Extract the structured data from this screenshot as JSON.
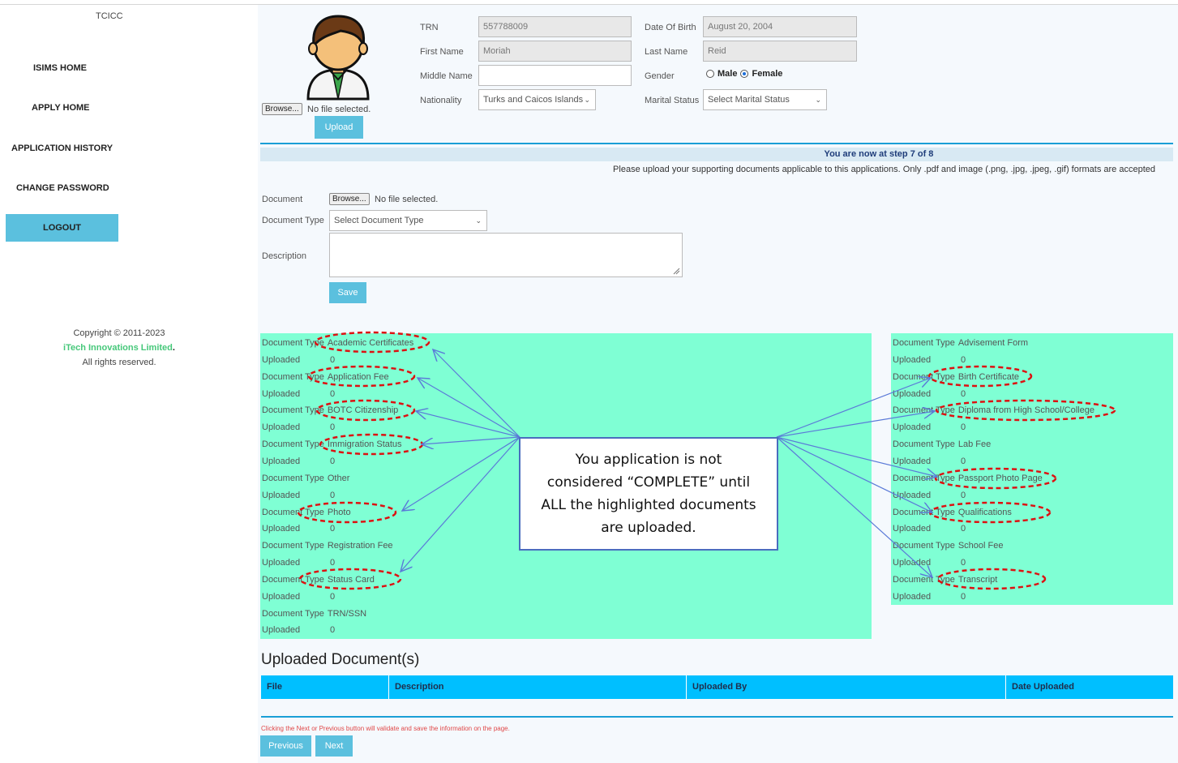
{
  "sidebar": {
    "brand": "TCICC",
    "items": [
      {
        "label": "ISIMS HOME"
      },
      {
        "label": "APPLY HOME"
      },
      {
        "label": "APPLICATION HISTORY"
      },
      {
        "label": "CHANGE PASSWORD"
      },
      {
        "label": "LOGOUT"
      }
    ],
    "copyright": "Copyright © 2011-2023",
    "company": "iTech Innovations Limited",
    "rights": "All rights reserved."
  },
  "profile": {
    "browse_label": "Browse...",
    "no_file": "No file selected.",
    "upload_label": "Upload",
    "trn_label": "TRN",
    "trn_value": "557788009",
    "dob_label": "Date Of Birth",
    "dob_value": "August 20, 2004",
    "first_name_label": "First Name",
    "first_name_value": "Moriah",
    "last_name_label": "Last Name",
    "last_name_value": "Reid",
    "middle_name_label": "Middle Name",
    "middle_name_value": "",
    "gender_label": "Gender",
    "gender_male": "Male",
    "gender_female": "Female",
    "nationality_label": "Nationality",
    "nationality_value": "Turks and Caicos Islands",
    "marital_label": "Marital Status",
    "marital_value": "Select Marital Status"
  },
  "step": {
    "text": "You are now at step 7 of 8",
    "instructions": "Please upload your supporting documents applicable to this applications. Only .pdf and image (.png, .jpg, .jpeg, .gif) formats are accepted"
  },
  "upload_form": {
    "document_label": "Document",
    "browse_label": "Browse...",
    "no_file": "No file selected.",
    "document_type_label": "Document Type",
    "document_type_value": "Select Document Type",
    "description_label": "Description",
    "save_label": "Save"
  },
  "doc_type_label": "Document Type",
  "uploaded_label": "Uploaded",
  "left_docs": [
    {
      "type": "Academic Certificates",
      "count": "0"
    },
    {
      "type": "Application Fee",
      "count": "0"
    },
    {
      "type": "BOTC Citizenship",
      "count": "0"
    },
    {
      "type": "Immigration Status",
      "count": "0"
    },
    {
      "type": "Other",
      "count": "0"
    },
    {
      "type": "Photo",
      "count": "0"
    },
    {
      "type": "Registration Fee",
      "count": "0"
    },
    {
      "type": "Status Card",
      "count": "0"
    },
    {
      "type": "TRN/SSN",
      "count": "0"
    }
  ],
  "right_docs": [
    {
      "type": "Advisement Form",
      "count": "0"
    },
    {
      "type": "Birth Certificate",
      "count": "0"
    },
    {
      "type": "Diploma from High School/College",
      "count": "0"
    },
    {
      "type": "Lab Fee",
      "count": "0"
    },
    {
      "type": "Passport Photo Page",
      "count": "0"
    },
    {
      "type": "Qualifications",
      "count": "0"
    },
    {
      "type": "School Fee",
      "count": "0"
    },
    {
      "type": "Transcript",
      "count": "0"
    }
  ],
  "callout": {
    "line1": "You application is not",
    "line2": "considered “COMPLETE” until",
    "line3": "ALL the highlighted documents",
    "line4": "are uploaded."
  },
  "uploaded_section": {
    "title": "Uploaded Document(s)",
    "columns": [
      "File",
      "Description",
      "Uploaded By",
      "Date Uploaded"
    ]
  },
  "footer": {
    "warning": "Clicking the Next or Previous button will validate and save the information on the page.",
    "previous_label": "Previous",
    "next_label": "Next"
  },
  "colors": {
    "accent": "#5bc0de",
    "panel_green": "#7fffd4",
    "table_header": "#00bfff",
    "highlight_red": "#dd1111",
    "arrow_blue": "#5b7ad8"
  }
}
